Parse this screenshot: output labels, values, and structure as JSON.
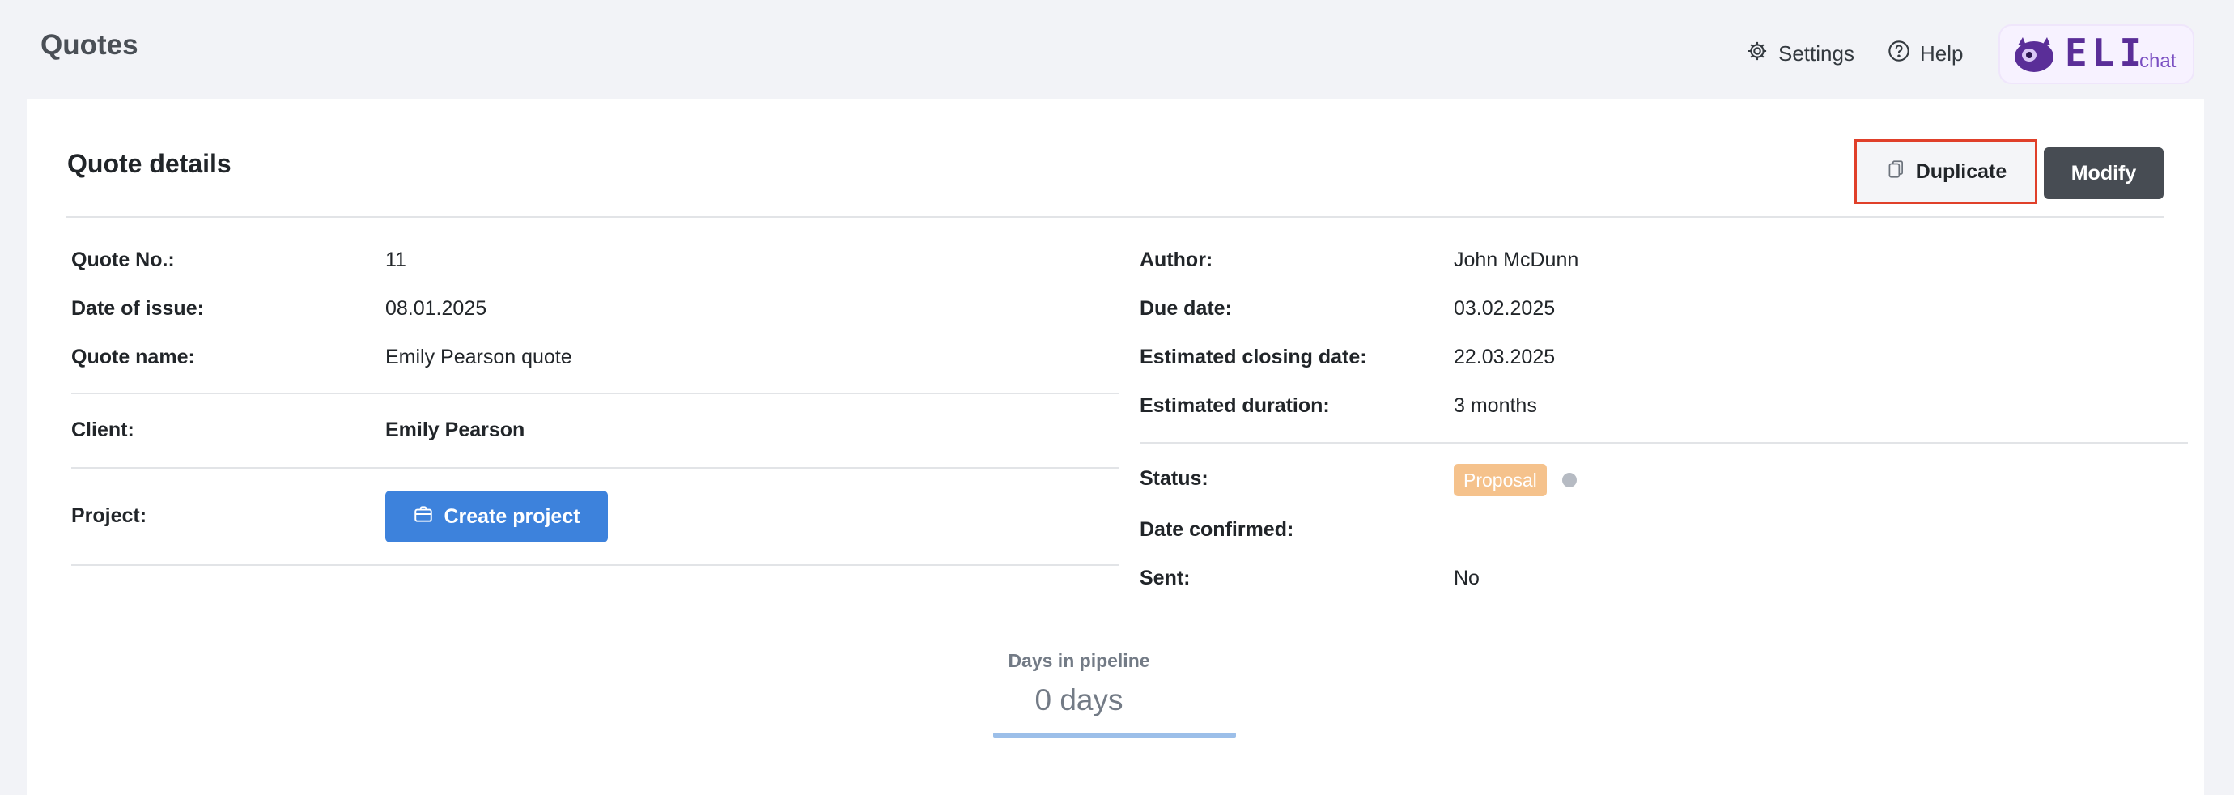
{
  "header": {
    "title": "Quotes",
    "settings_label": "Settings",
    "help_label": "Help",
    "eli": {
      "logo_text": "ELI",
      "chat_label": "chat"
    }
  },
  "card": {
    "title": "Quote details",
    "duplicate_label": "Duplicate",
    "modify_label": "Modify"
  },
  "left_fields": {
    "quote_no": {
      "label": "Quote No.:",
      "value": "11"
    },
    "date_of_issue": {
      "label": "Date of issue:",
      "value": "08.01.2025"
    },
    "quote_name": {
      "label": "Quote name:",
      "value": "Emily Pearson quote"
    },
    "client": {
      "label": "Client:",
      "value": "Emily Pearson"
    },
    "project": {
      "label": "Project:",
      "button_label": "Create project"
    }
  },
  "right_fields": {
    "author": {
      "label": "Author:",
      "value": "John McDunn"
    },
    "due_date": {
      "label": "Due date:",
      "value": "03.02.2025"
    },
    "estimated_closing_date": {
      "label": "Estimated closing date:",
      "value": "22.03.2025"
    },
    "estimated_duration": {
      "label": "Estimated duration:",
      "value": "3 months"
    },
    "status": {
      "label": "Status:",
      "value": "Proposal"
    },
    "date_confirmed": {
      "label": "Date confirmed:",
      "value": ""
    },
    "sent": {
      "label": "Sent:",
      "value": "No"
    }
  },
  "pipeline": {
    "label": "Days in pipeline",
    "value": "0 days"
  },
  "colors": {
    "primary": "#3d82dc",
    "modify_button": "#474c53",
    "status_proposal": "#f5c28c",
    "highlight_border": "#e0402a",
    "brand_purple": "#5a2e98"
  },
  "icons": {
    "settings": "gear-icon",
    "help": "help-circle-icon",
    "duplicate": "copy-icon",
    "create_project": "briefcase-icon",
    "eli": "eli-mascot-icon"
  }
}
